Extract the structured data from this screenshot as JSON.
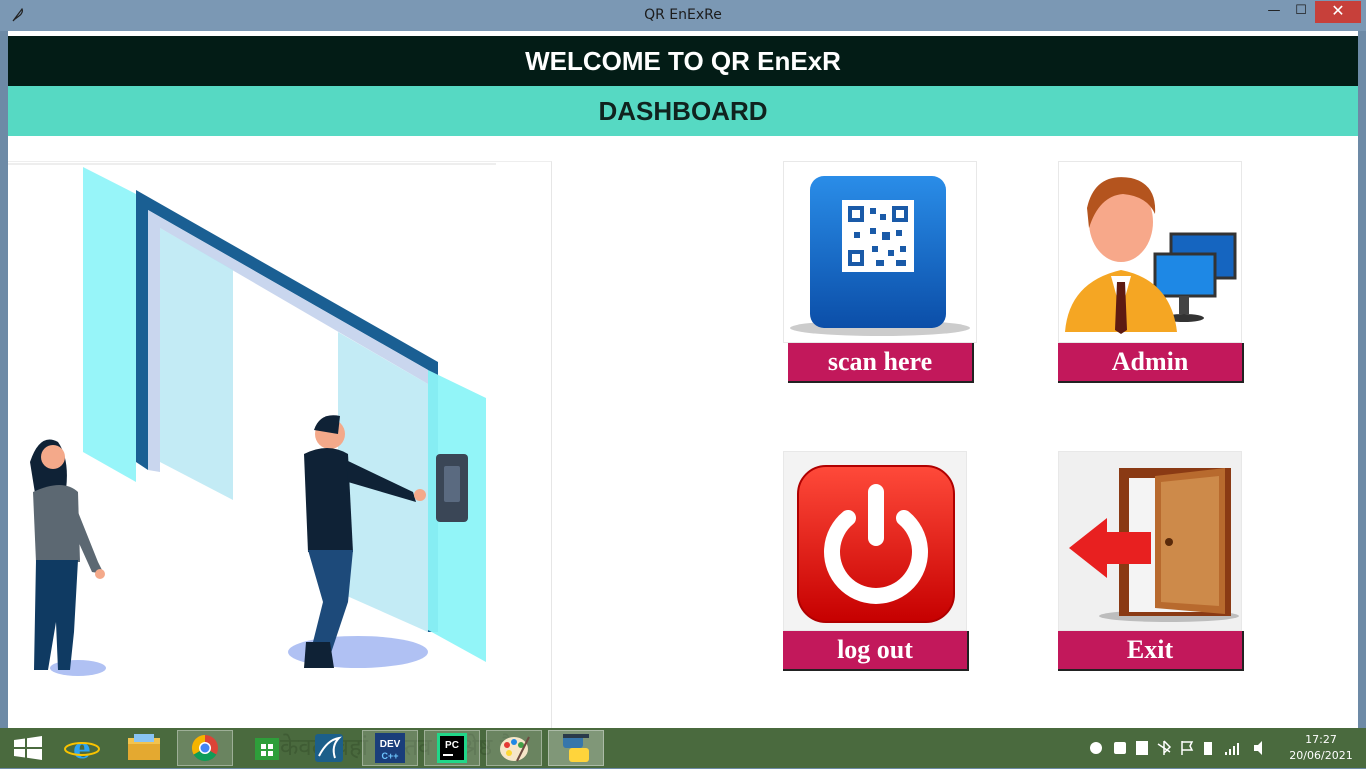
{
  "window": {
    "title": "QR EnExRe",
    "minimize_glyph": "—",
    "maximize_glyph": "☐",
    "close_glyph": "✕"
  },
  "header": {
    "welcome": "WELCOME TO QR EnExR",
    "subtitle": "DASHBOARD"
  },
  "tiles": {
    "scan": {
      "label": "scan here",
      "icon": "qr-code-icon"
    },
    "admin": {
      "label": "Admin",
      "icon": "admin-user-icon"
    },
    "logout": {
      "label": "log out",
      "icon": "power-icon"
    },
    "exit": {
      "label": "Exit",
      "icon": "exit-door-icon"
    }
  },
  "taskbar": {
    "background_text": "केवल वहां वास्तव में श्रेष्ठ है।",
    "apps": [
      "start",
      "internet-explorer",
      "file-explorer",
      "chrome",
      "store",
      "mysql-workbench",
      "dev-cpp",
      "pycharm",
      "paint",
      "python"
    ],
    "clock": {
      "time": "17:27",
      "date": "20/06/2021"
    }
  },
  "colors": {
    "header_dark": "#031c16",
    "header_teal": "#56d9c3",
    "label_magenta": "#c2185b"
  }
}
